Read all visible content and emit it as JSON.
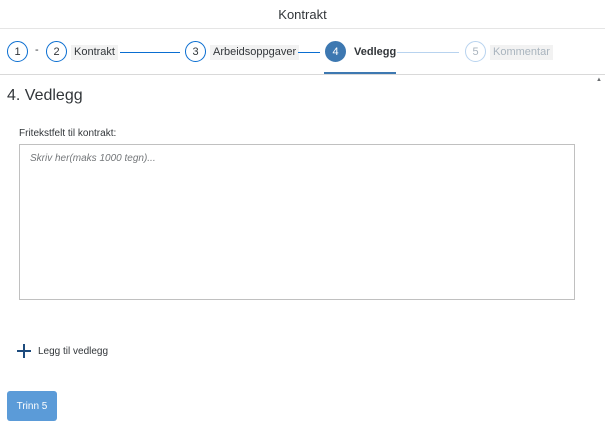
{
  "header": {
    "title": "Kontrakt"
  },
  "wizard": {
    "steps": [
      {
        "number": "1",
        "label": "",
        "state": "completed"
      },
      {
        "number": "2",
        "label": "Kontrakt",
        "state": "completed"
      },
      {
        "number": "3",
        "label": "Arbeidsoppgaver",
        "state": "completed"
      },
      {
        "number": "4",
        "label": "Vedlegg",
        "state": "active"
      },
      {
        "number": "5",
        "label": "Kommentar",
        "state": "disabled"
      }
    ],
    "separator": "-"
  },
  "section": {
    "title": "4. Vedlegg"
  },
  "free_text": {
    "label": "Fritekstfelt til kontrakt:",
    "value": "",
    "placeholder": "Skriv her(maks 1000 tegn)..."
  },
  "attachment": {
    "icon": "plus-icon",
    "label": "Legg til vedlegg"
  },
  "footer": {
    "next_button_label": "Trinn 5"
  },
  "colors": {
    "accent": "#3d78b1",
    "link": "#0a6ed1",
    "button": "#5b9bd8",
    "disabled": "#b8d3ef"
  }
}
